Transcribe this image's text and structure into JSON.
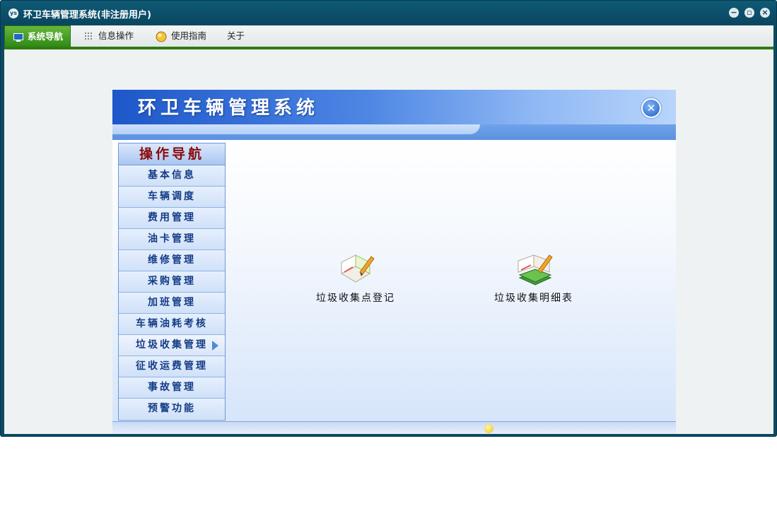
{
  "window": {
    "title": "环卫车辆管理系统(非注册用户)",
    "app_icon_text": "ys"
  },
  "menu": {
    "items": [
      {
        "label": "系统导航",
        "icon": "monitor-icon",
        "active": true
      },
      {
        "label": "信息操作",
        "icon": "grid-icon",
        "active": false
      },
      {
        "label": "使用指南",
        "icon": "lightbulb-icon",
        "active": false
      },
      {
        "label": "关于",
        "icon": "",
        "active": false
      }
    ]
  },
  "banner": {
    "title": "环卫车辆管理系统"
  },
  "nav": {
    "header": "操作导航",
    "items": [
      {
        "label": "基本信息"
      },
      {
        "label": "车辆调度"
      },
      {
        "label": "费用管理"
      },
      {
        "label": "油卡管理"
      },
      {
        "label": "维修管理"
      },
      {
        "label": "采购管理"
      },
      {
        "label": "加班管理"
      },
      {
        "label": "车辆油耗考核"
      },
      {
        "label": "垃圾收集管理",
        "active": true
      },
      {
        "label": "征收运费管理"
      },
      {
        "label": "事故管理"
      },
      {
        "label": "预警功能"
      }
    ]
  },
  "functions": [
    {
      "label": "垃圾收集点登记",
      "icon": "book-pen-icon"
    },
    {
      "label": "垃圾收集明细表",
      "icon": "books-pen-icon"
    }
  ],
  "colors": {
    "titlebar": "#0b4a63",
    "menu_accent": "#2e7d12",
    "nav_header_text": "#8b0a0a",
    "nav_item_text": "#143c86"
  }
}
